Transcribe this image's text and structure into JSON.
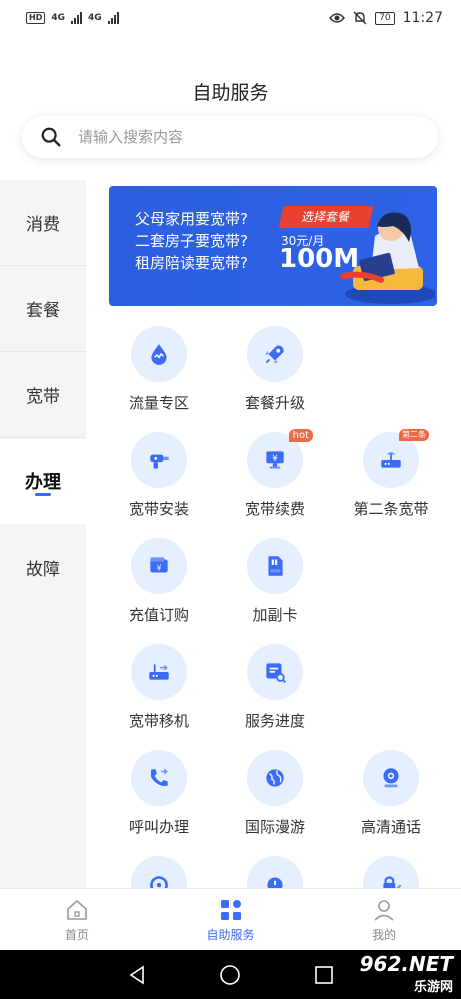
{
  "status_bar": {
    "hd": "HD",
    "net1": "4G",
    "net2": "4G",
    "battery": "70",
    "time": "11:27"
  },
  "page": {
    "title": "自助服务"
  },
  "search": {
    "placeholder": "请输入搜索内容"
  },
  "sidebar": {
    "items": [
      {
        "label": "消费"
      },
      {
        "label": "套餐"
      },
      {
        "label": "宽带"
      },
      {
        "label": "办理"
      },
      {
        "label": "故障"
      }
    ],
    "active": "办理"
  },
  "banner": {
    "lines": [
      "父母家用要宽带?",
      "二套房子要宽带?",
      "租房陪读要宽带?"
    ],
    "tag": "选择套餐",
    "price": "30元/月",
    "speed": "100M"
  },
  "services": [
    {
      "label": "流量专区",
      "icon": "water-drop-icon"
    },
    {
      "label": "套餐升级",
      "icon": "rocket-icon"
    },
    {
      "label": "宽带安装",
      "icon": "drill-icon"
    },
    {
      "label": "宽带续费",
      "icon": "monitor-yen-icon",
      "badge": "hot"
    },
    {
      "label": "第二条宽带",
      "icon": "router-icon",
      "badge": "第二条"
    },
    {
      "label": "充值订购",
      "icon": "wallet-icon"
    },
    {
      "label": "加副卡",
      "icon": "sim-card-icon"
    },
    {
      "label": "宽带移机",
      "icon": "router-move-icon"
    },
    {
      "label": "服务进度",
      "icon": "progress-search-icon"
    },
    {
      "label": "呼叫办理",
      "icon": "phone-icon"
    },
    {
      "label": "国际漫游",
      "icon": "globe-icon"
    },
    {
      "label": "高清通话",
      "icon": "webcam-icon"
    }
  ],
  "tabbar": {
    "items": [
      {
        "label": "首页",
        "icon": "home-icon"
      },
      {
        "label": "自助服务",
        "icon": "grid-icon"
      },
      {
        "label": "我的",
        "icon": "user-icon"
      }
    ],
    "active": "自助服务"
  },
  "watermark": {
    "brand": "962.NET",
    "sub": "乐游网"
  },
  "colors": {
    "accent": "#3b6cf6",
    "icon_bg": "#e6effd",
    "badge": "#ee6a44",
    "banner": "#2b5fe0"
  }
}
